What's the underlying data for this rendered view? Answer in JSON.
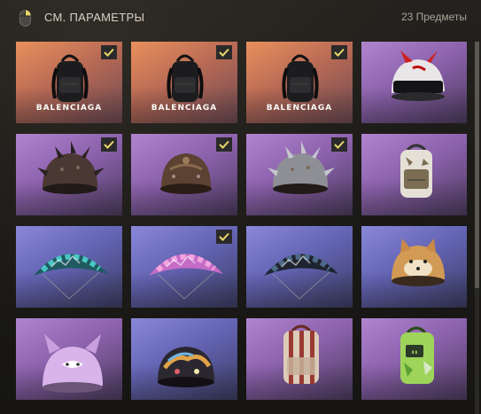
{
  "header": {
    "title": "СМ. ПАРАМЕТРЫ",
    "count": "23 Предметы",
    "icon": "mouse-icon"
  },
  "colors": {
    "check_mark": "#e9d86a",
    "rarity_orange": "#e8905c",
    "rarity_purple": "#b184ce",
    "rarity_blue": "#8a88d8"
  },
  "items": [
    {
      "name": "black-backpack-balenciaga",
      "rarity": "orange",
      "checked": true,
      "brand": "BALENCIAGA"
    },
    {
      "name": "black-backpack-balenciaga-2",
      "rarity": "orange",
      "checked": true,
      "brand": "BALENCIAGA"
    },
    {
      "name": "black-backpack-balenciaga-3",
      "rarity": "orange",
      "checked": true,
      "brand": "BALENCIAGA"
    },
    {
      "name": "white-red-horned-helmet",
      "rarity": "purple",
      "checked": false,
      "brand": ""
    },
    {
      "name": "spiked-dark-helmet",
      "rarity": "purple",
      "checked": true,
      "brand": ""
    },
    {
      "name": "rusty-riveted-helmet",
      "rarity": "purple",
      "checked": true,
      "brand": ""
    },
    {
      "name": "silver-spiked-helmet",
      "rarity": "purple",
      "checked": true,
      "brand": ""
    },
    {
      "name": "white-camo-backpack",
      "rarity": "purple",
      "checked": false,
      "brand": ""
    },
    {
      "name": "teal-graffiti-parachute",
      "rarity": "blue",
      "checked": false,
      "brand": ""
    },
    {
      "name": "pink-graffiti-parachute",
      "rarity": "blue",
      "checked": true,
      "brand": ""
    },
    {
      "name": "dark-graffiti-parachute",
      "rarity": "blue",
      "checked": false,
      "brand": ""
    },
    {
      "name": "shiba-dog-helmet",
      "rarity": "blue",
      "checked": false,
      "brand": ""
    },
    {
      "name": "lilac-cat-helmet",
      "rarity": "purple",
      "checked": false,
      "brand": ""
    },
    {
      "name": "graffiti-helmet",
      "rarity": "blue",
      "checked": false,
      "brand": ""
    },
    {
      "name": "striped-beige-backpack",
      "rarity": "purple",
      "checked": false,
      "brand": ""
    },
    {
      "name": "green-camo-backpack",
      "rarity": "purple",
      "checked": false,
      "brand": ""
    }
  ]
}
